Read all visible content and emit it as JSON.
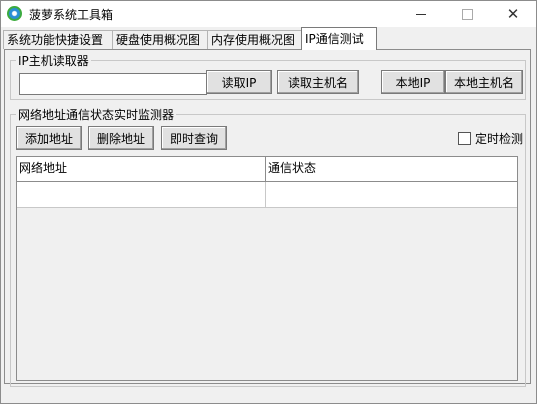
{
  "window": {
    "title": "菠萝系统工具箱"
  },
  "tabs": [
    {
      "label": "系统功能快捷设置"
    },
    {
      "label": "硬盘使用概况图"
    },
    {
      "label": "内存使用概况图"
    },
    {
      "label": "IP通信测试",
      "active": true
    }
  ],
  "ip_reader": {
    "title": "IP主机读取器",
    "input_value": "",
    "buttons": {
      "read_ip": "读取IP",
      "read_hostname": "读取主机名",
      "local_ip": "本地IP",
      "local_hostname": "本地主机名"
    }
  },
  "monitor": {
    "title": "网络地址通信状态实时监测器",
    "buttons": {
      "add": "添加地址",
      "delete": "删除地址",
      "query": "即时查询"
    },
    "timer_check": {
      "label": "定时检测",
      "checked": false
    },
    "columns": [
      "网络地址",
      "通信状态"
    ],
    "rows": [
      {
        "address": "",
        "status": ""
      }
    ]
  }
}
